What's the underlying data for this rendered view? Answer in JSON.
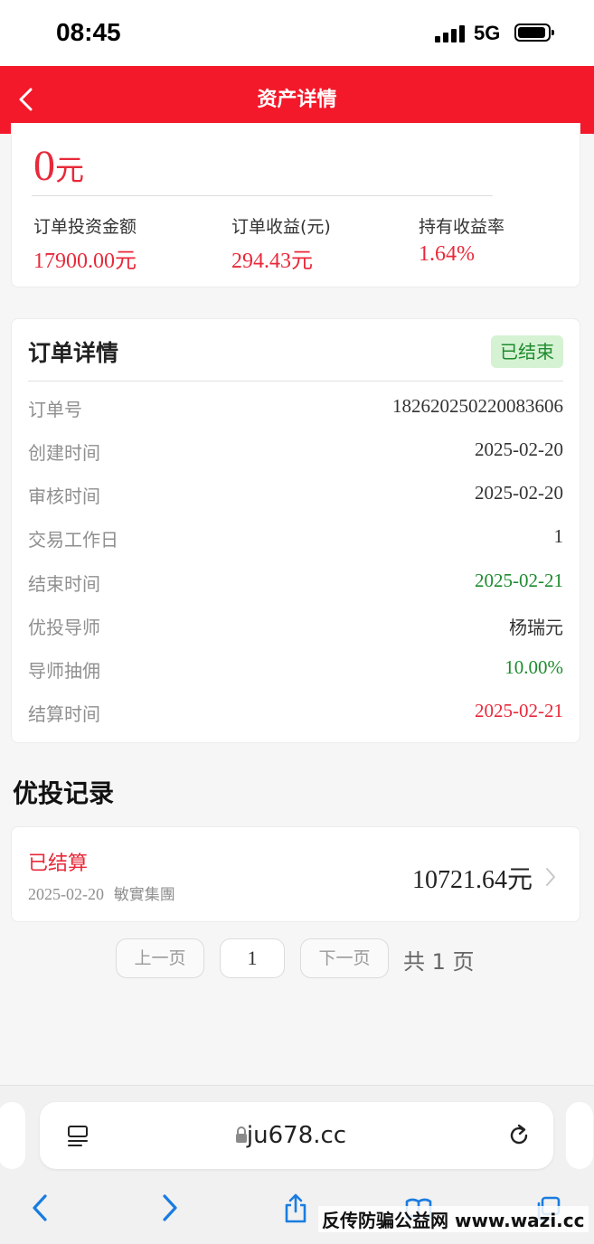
{
  "status_bar": {
    "time": "08:45",
    "network": "5G"
  },
  "header": {
    "title": "资产详情"
  },
  "asset": {
    "amount": "0",
    "amount_unit": "元",
    "stats": [
      {
        "label": "订单投资金额",
        "value": "17900.00元"
      },
      {
        "label": "订单收益(元)",
        "value": "294.43元"
      },
      {
        "label": "持有收益率",
        "value": "1.64%"
      }
    ]
  },
  "order": {
    "title": "订单详情",
    "status": "已结束",
    "rows": [
      {
        "label": "订单号",
        "value": "182620250220083606"
      },
      {
        "label": "创建时间",
        "value": "2025-02-20"
      },
      {
        "label": "审核时间",
        "value": "2025-02-20"
      },
      {
        "label": "交易工作日",
        "value": "1"
      },
      {
        "label": "结束时间",
        "value": "2025-02-21"
      },
      {
        "label": "优投导师",
        "value": "杨瑞元"
      },
      {
        "label": "导师抽佣",
        "value": "10.00%"
      },
      {
        "label": "结算时间",
        "value": "2025-02-21"
      }
    ]
  },
  "records": {
    "title": "优投记录",
    "items": [
      {
        "status": "已结算",
        "date": "2025-02-20",
        "company": "敏實集團",
        "amount": "10721.64元"
      }
    ]
  },
  "pager": {
    "prev": "上一页",
    "page": "1",
    "next": "下一页",
    "total": "共 1 页"
  },
  "browser": {
    "url": "ju678.cc"
  },
  "watermark": "反传防骗公益网 www.wazi.cc",
  "colors": {
    "brand_red": "#f3192a",
    "accent_red": "#e8293a",
    "success_green": "#1e8b2e",
    "link_blue": "#1a7ce0"
  }
}
